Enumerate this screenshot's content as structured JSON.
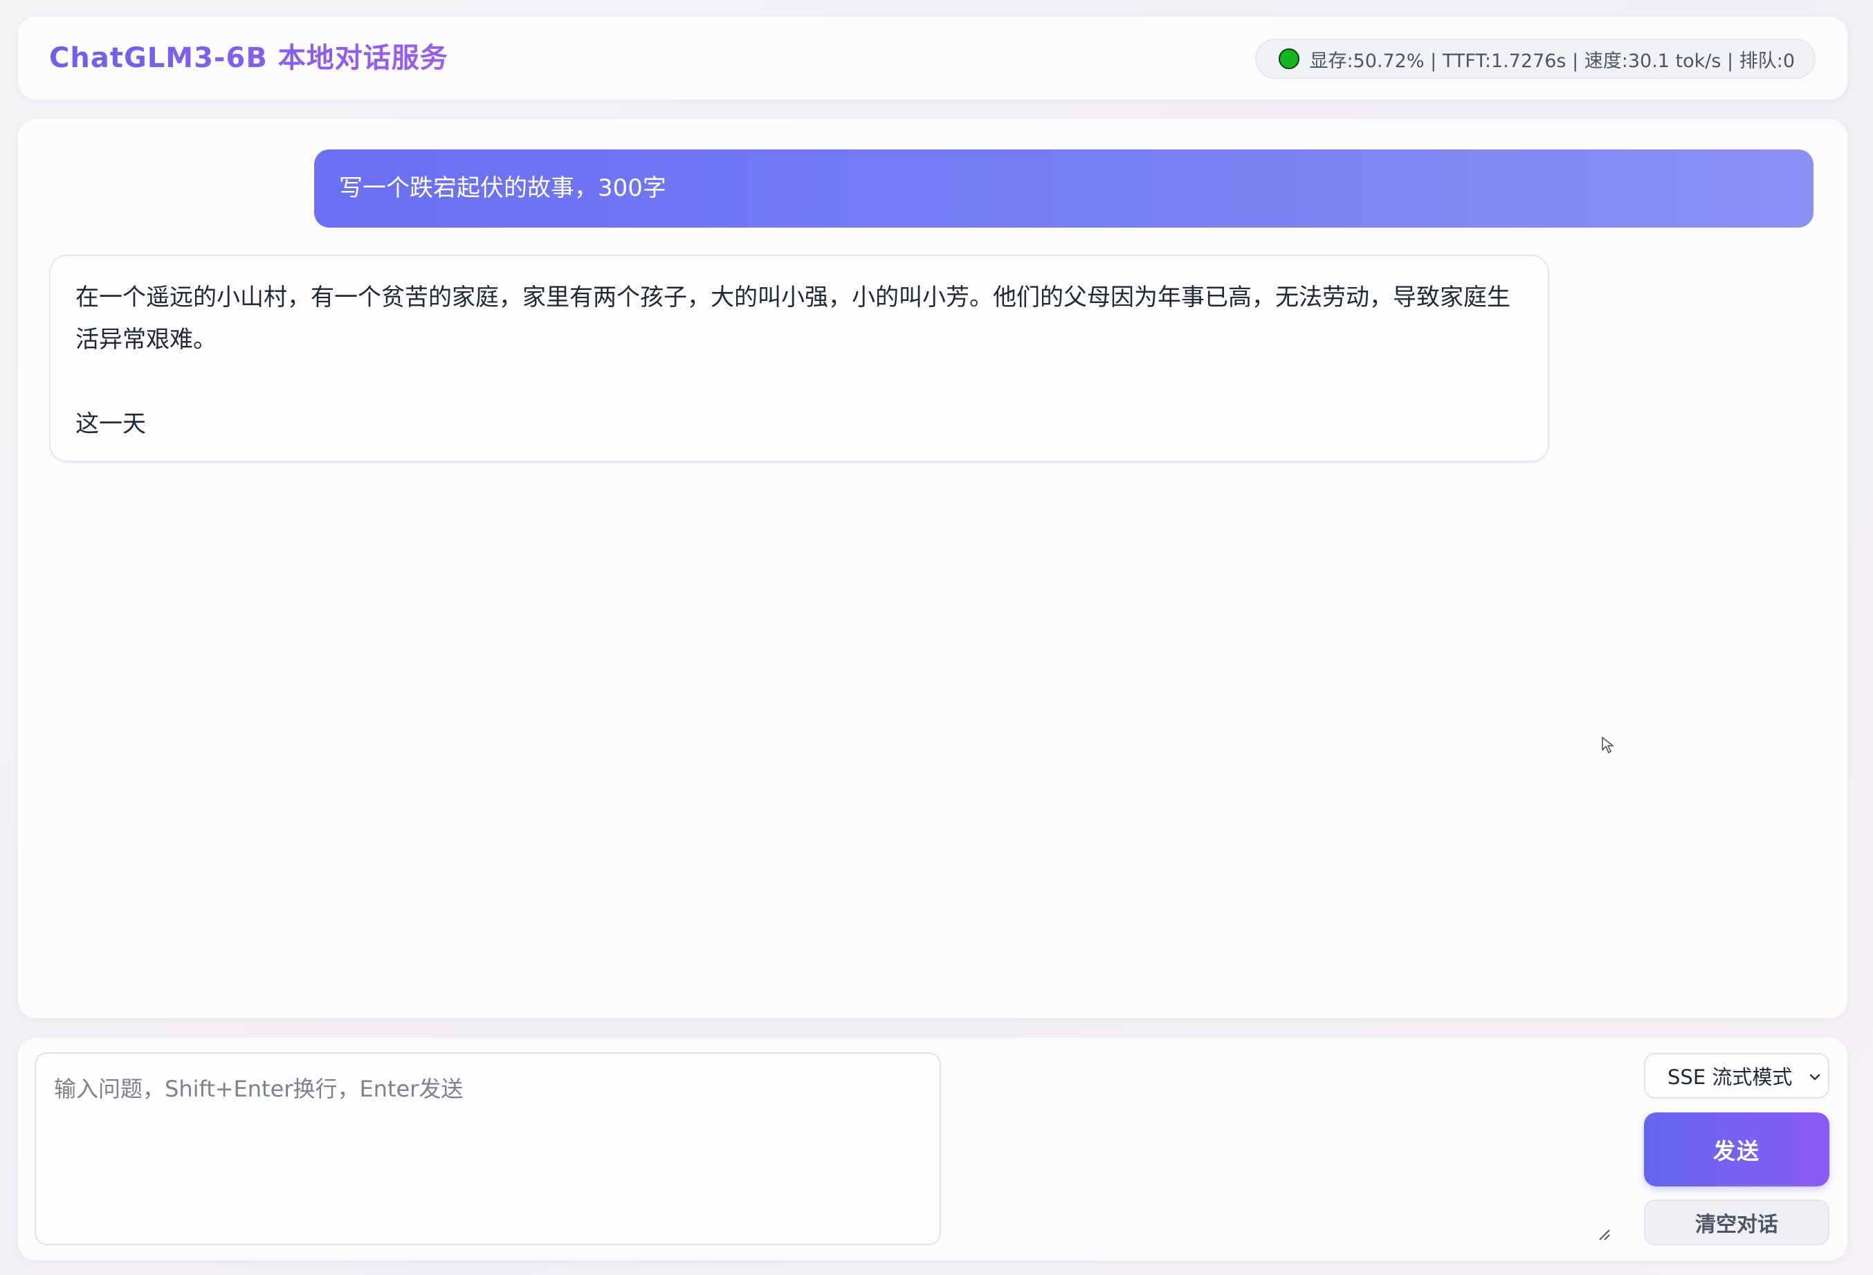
{
  "header": {
    "title": "ChatGLM3-6B 本地对话服务",
    "status_text": "显存:50.72% | TTFT:1.7276s | 速度:30.1 tok/s | 排队:0",
    "status_color": "#13b81f"
  },
  "chat": {
    "messages": [
      {
        "role": "user",
        "text": "写一个跌宕起伏的故事，300字"
      },
      {
        "role": "assistant",
        "text": "在一个遥远的小山村，有一个贫苦的家庭，家里有两个孩子，大的叫小强，小的叫小芳。他们的父母因为年事已高，无法劳动，导致家庭生活异常艰难。\n\n这一天"
      }
    ]
  },
  "composer": {
    "placeholder": "输入问题，Shift+Enter换行，Enter发送",
    "value": "",
    "mode_selected": "SSE 流式模式",
    "send_label": "发送",
    "clear_label": "清空对话"
  },
  "colors": {
    "accent_start": "#6366f1",
    "accent_end": "#8b5cf6",
    "user_bubble": "#777ff4"
  }
}
